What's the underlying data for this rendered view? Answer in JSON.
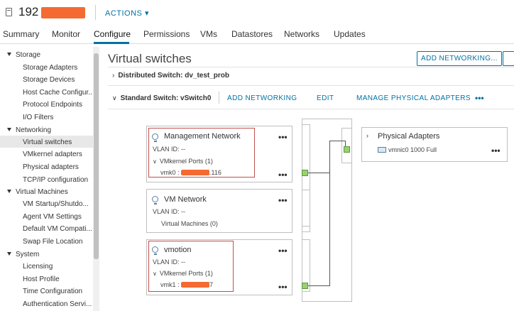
{
  "header": {
    "host_name": "192",
    "actions": "ACTIONS ▾"
  },
  "tabs": [
    "Summary",
    "Monitor",
    "Configure",
    "Permissions",
    "VMs",
    "Datastores",
    "Networks",
    "Updates"
  ],
  "active_tab": "Configure",
  "sidebar": {
    "groups": [
      {
        "label": "Storage",
        "items": [
          "Storage Adapters",
          "Storage Devices",
          "Host Cache Configur...",
          "Protocol Endpoints",
          "I/O Filters"
        ]
      },
      {
        "label": "Networking",
        "items": [
          "Virtual switches",
          "VMkernel adapters",
          "Physical adapters",
          "TCP/IP configuration"
        ]
      },
      {
        "label": "Virtual Machines",
        "items": [
          "VM Startup/Shutdo...",
          "Agent VM Settings",
          "Default VM Compati...",
          "Swap File Location"
        ]
      },
      {
        "label": "System",
        "items": [
          "Licensing",
          "Host Profile",
          "Time Configuration",
          "Authentication Servi..."
        ]
      }
    ],
    "selected": "Virtual switches"
  },
  "main": {
    "title": "Virtual switches",
    "add_networking_button": "ADD NETWORKING...",
    "distributed_switch": "Distributed Switch: dv_test_prob",
    "standard_switch": "Standard Switch: vSwitch0",
    "actions": {
      "add_networking": "ADD NETWORKING",
      "edit": "EDIT",
      "manage_adapters": "MANAGE PHYSICAL ADAPTERS",
      "more": "•••"
    }
  },
  "port_groups": [
    {
      "name": "Management Network",
      "vlan": "VLAN ID: --",
      "ports_label": "VMkernel Ports (1)",
      "port_prefix": "vmk0 : ",
      "port_suffix": ".116"
    },
    {
      "name": "VM Network",
      "vlan": "VLAN ID: --",
      "vm_label": "Virtual Machines (0)"
    },
    {
      "name": "vmotion",
      "vlan": "VLAN ID: --",
      "ports_label": "VMkernel Ports (1)",
      "port_prefix": "vmk1 : ",
      "port_suffix": "7"
    }
  ],
  "physical_adapters": {
    "title": "Physical Adapters",
    "nic": "vmnic0 1000 Full"
  },
  "more_dots": "•••",
  "colors": {
    "accent": "#0072a3",
    "highlight": "#c0504d",
    "redaction": "#f46a32",
    "port": "#9bd070"
  }
}
